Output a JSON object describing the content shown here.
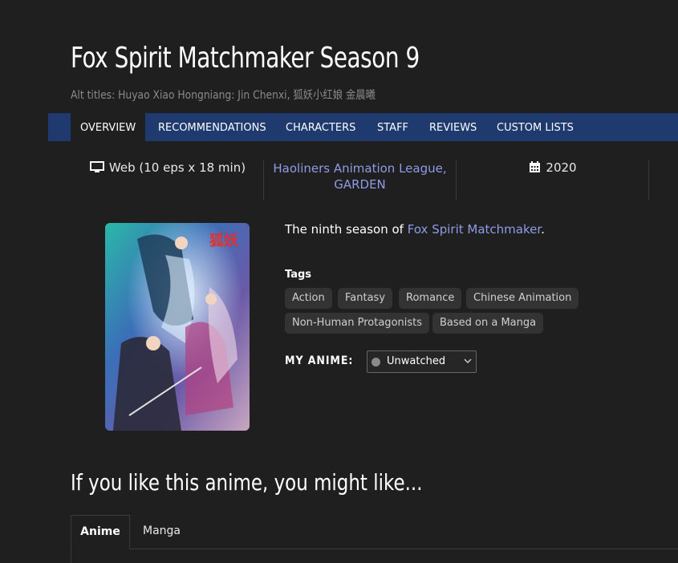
{
  "header": {
    "title": "Fox Spirit Matchmaker Season 9",
    "alt_titles": "Alt titles: Huyao Xiao Hongniang: Jin Chenxi, 狐妖小红娘 金晨曦"
  },
  "nav": {
    "tabs": [
      {
        "label": "OVERVIEW",
        "active": true
      },
      {
        "label": "RECOMMENDATIONS"
      },
      {
        "label": "CHARACTERS"
      },
      {
        "label": "STAFF"
      },
      {
        "label": "REVIEWS"
      },
      {
        "label": "CUSTOM LISTS"
      }
    ]
  },
  "info": {
    "format": "Web (10 eps x 18 min)",
    "format_icon": "monitor-icon",
    "studios": "Haoliners Animation League,",
    "studios_line2": "GARDEN",
    "year": "2020",
    "year_icon": "calendar-icon"
  },
  "poster": {
    "icon": "poster-image"
  },
  "description": {
    "prefix": "The ninth season of ",
    "link": "Fox Spirit Matchmaker",
    "suffix": "."
  },
  "tags": {
    "label": "Tags",
    "items": [
      "Action",
      "Fantasy",
      "Romance",
      "Chinese Animation",
      "Non-Human Protagonists",
      "Based on a Manga"
    ]
  },
  "my_anime": {
    "label": "MY ANIME:",
    "status": "Unwatched"
  },
  "recommendations": {
    "title": "If you like this anime, you might like...",
    "tabs": [
      "Anime",
      "Manga"
    ]
  },
  "colors": {
    "nav_bg": "#1e3a6e",
    "link": "#8f9be6",
    "background": "#1f1f1f"
  }
}
